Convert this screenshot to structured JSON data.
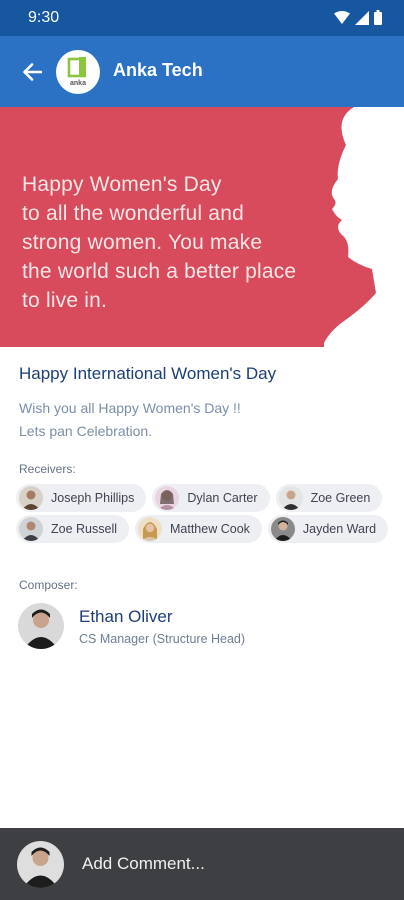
{
  "status_bar": {
    "time": "9:30",
    "icons": [
      "wifi-icon",
      "signal-icon",
      "battery-icon"
    ]
  },
  "app_bar": {
    "title": "Anka Tech",
    "logo_text": "anka",
    "back_icon": "arrow-left-icon",
    "color": "#2b72c4"
  },
  "banner": {
    "lines": [
      "Happy Women's Day",
      "to all the wonderful and",
      "strong women. You make",
      "the world such a better place",
      "to live in."
    ],
    "background": "#d84b5c"
  },
  "post": {
    "title": "Happy International Women's Day",
    "message_lines": [
      "Wish you all Happy Women's Day !!",
      "Lets pan Celebration."
    ]
  },
  "receivers": {
    "label": "Receivers:",
    "rows": [
      [
        {
          "name": "Joseph Phillips"
        },
        {
          "name": "Dylan Carter"
        },
        {
          "name": "Zoe Green"
        }
      ],
      [
        {
          "name": "Zoe Russell"
        },
        {
          "name": "Matthew Cook"
        },
        {
          "name": "Jayden Ward"
        }
      ]
    ]
  },
  "composer": {
    "label": "Composer:",
    "name": "Ethan Oliver",
    "role": "CS Manager (Structure Head)"
  },
  "comment": {
    "placeholder": "Add Comment..."
  }
}
